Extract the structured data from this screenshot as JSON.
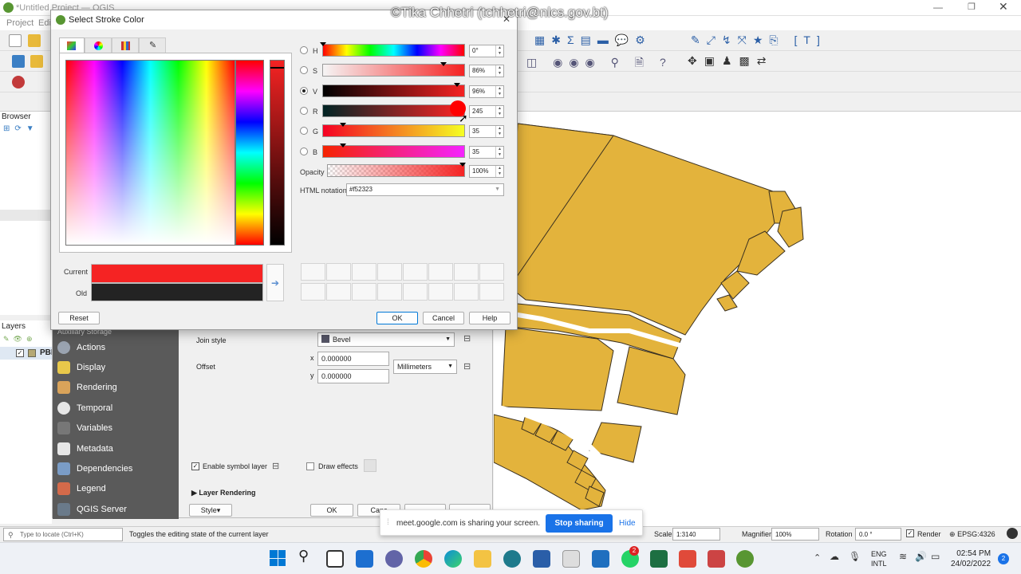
{
  "watermark": "©Tika Chhetri (tchhetri@nlcs.gov.bt)",
  "qgis": {
    "window_title": "*Untitled Project — QGIS",
    "menu": [
      "Project",
      "Edit"
    ],
    "browser_label": "Browser",
    "layers_label": "Layers",
    "layer_name": "PBD",
    "status_locate_placeholder": "Type to locate (Ctrl+K)",
    "status_message": "Toggles the editing state of the current layer",
    "scale_label": "Scale",
    "scale_value": "1:3140",
    "magnifier_label": "Magnifier",
    "magnifier_value": "100%",
    "rotation_label": "Rotation",
    "rotation_value": "0.0 °",
    "render_label": "Render",
    "crs_label": "EPSG:4326"
  },
  "props_dialog": {
    "sidebar": [
      {
        "label": "Auxiliary Storage",
        "icon": "storage-icon",
        "color": "#8a8a8a"
      },
      {
        "label": "Actions",
        "icon": "gear-icon",
        "color": "#9aa3b0"
      },
      {
        "label": "Display",
        "icon": "speech-bubble-icon",
        "color": "#e8c84a"
      },
      {
        "label": "Rendering",
        "icon": "brush-icon",
        "color": "#d9a35a"
      },
      {
        "label": "Temporal",
        "icon": "clock-icon",
        "color": "#e6e6e6"
      },
      {
        "label": "Variables",
        "icon": "variables-icon",
        "color": "#777777"
      },
      {
        "label": "Metadata",
        "icon": "document-icon",
        "color": "#e6e6e6"
      },
      {
        "label": "Dependencies",
        "icon": "dependencies-icon",
        "color": "#7a9cc6"
      },
      {
        "label": "Legend",
        "icon": "legend-icon",
        "color": "#d46a4a"
      },
      {
        "label": "QGIS Server",
        "icon": "server-icon",
        "color": "#6a7a8a"
      }
    ],
    "join_style_label": "Join style",
    "join_style_value": "Bevel",
    "offset_label": "Offset",
    "offset_x_label": "x",
    "offset_x": "0.000000",
    "offset_y_label": "y",
    "offset_y": "0.000000",
    "offset_unit": "Millimeters",
    "enable_symbol_layer": "Enable symbol layer",
    "draw_effects": "Draw effects",
    "layer_rendering": "Layer Rendering",
    "style_button": "Style",
    "ok_button": "OK",
    "cancel_button": "Canc"
  },
  "color_dialog": {
    "title": "Select Stroke Color",
    "tabs": [
      "color-ramp-icon",
      "color-wheel-icon",
      "swatch-grid-icon",
      "eyedropper-icon"
    ],
    "channels": [
      {
        "key": "H",
        "value": "0°",
        "fraction": 0.0,
        "selected": false
      },
      {
        "key": "S",
        "value": "86%",
        "fraction": 0.86,
        "selected": false
      },
      {
        "key": "V",
        "value": "96%",
        "fraction": 0.96,
        "selected": true
      },
      {
        "key": "R",
        "value": "245",
        "fraction": 0.96,
        "selected": false
      },
      {
        "key": "G",
        "value": "35",
        "fraction": 0.14,
        "selected": false
      },
      {
        "key": "B",
        "value": "35",
        "fraction": 0.14,
        "selected": false
      }
    ],
    "opacity_label": "Opacity",
    "opacity_value": "100%",
    "html_notation_label": "HTML notation",
    "html_notation_value": "#f52323",
    "current_label": "Current",
    "old_label": "Old",
    "current_color": "#f52323",
    "old_color": "#232323",
    "reset_button": "Reset",
    "ok_button": "OK",
    "cancel_button": "Cancel",
    "help_button": "Help"
  },
  "share_bar": {
    "message": "meet.google.com is sharing your screen.",
    "stop_button": "Stop sharing",
    "hide_button": "Hide"
  },
  "taskbar": {
    "lang": "ENG",
    "layout": "INTL",
    "time": "02:54 PM",
    "date": "24/02/2022",
    "notification_count": "2",
    "whatsapp_badge": "2"
  },
  "map_fill_color": "#e3b33c"
}
